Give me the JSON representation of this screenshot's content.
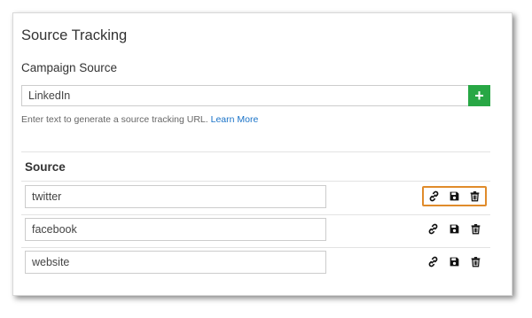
{
  "panel": {
    "title": "Source Tracking",
    "campaign_label": "Campaign Source",
    "campaign_value": "LinkedIn",
    "add_label": "+",
    "help_text": "Enter text to generate a source tracking URL.",
    "help_link": "Learn More"
  },
  "table": {
    "header": "Source",
    "rows": [
      {
        "value": "twitter",
        "highlighted": true
      },
      {
        "value": "facebook",
        "highlighted": false
      },
      {
        "value": "website",
        "highlighted": false
      }
    ]
  },
  "icons": [
    "link-icon",
    "save-icon",
    "trash-icon"
  ],
  "colors": {
    "add_button": "#28a745",
    "link": "#1a73c8",
    "highlight_border": "#e08b2b"
  }
}
